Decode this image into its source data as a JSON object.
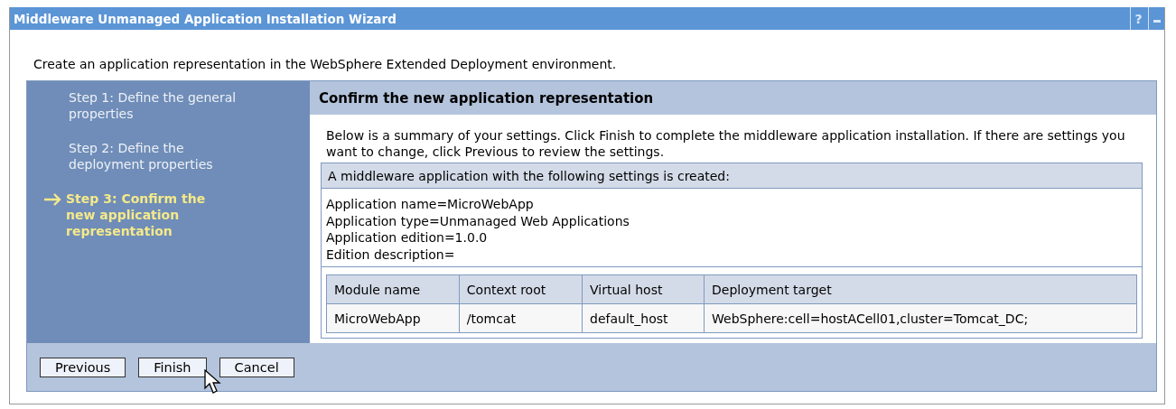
{
  "window": {
    "title": "Middleware Unmanaged Application Installation Wizard",
    "help": "?"
  },
  "intro": "Create an application representation in the WebSphere Extended Deployment environment.",
  "steps": [
    {
      "label": "Step 1: Define the general properties",
      "selected": false
    },
    {
      "label": "Step 2: Define the deployment properties",
      "selected": false
    },
    {
      "label": "Step 3: Confirm the new application representation",
      "selected": true
    }
  ],
  "content": {
    "heading": "Confirm the new application representation",
    "description": "Below is a summary of your settings. Click Finish to complete the middleware application installation. If there are settings you want to change, click Previous to review the settings.",
    "summary_title": "A middleware application with the following settings is created:",
    "settings": [
      "Application name=MicroWebApp",
      "Application type=Unmanaged Web Applications",
      "Application edition=1.0.0",
      "Edition description="
    ],
    "table": {
      "columns": [
        "Module name",
        "Context root",
        "Virtual host",
        "Deployment target"
      ],
      "rows": [
        [
          "MicroWebApp",
          "/tomcat",
          "default_host",
          "WebSphere:cell=hostACell01,cluster=Tomcat_DC;"
        ]
      ]
    }
  },
  "buttons": [
    "Previous",
    "Finish",
    "Cancel"
  ]
}
